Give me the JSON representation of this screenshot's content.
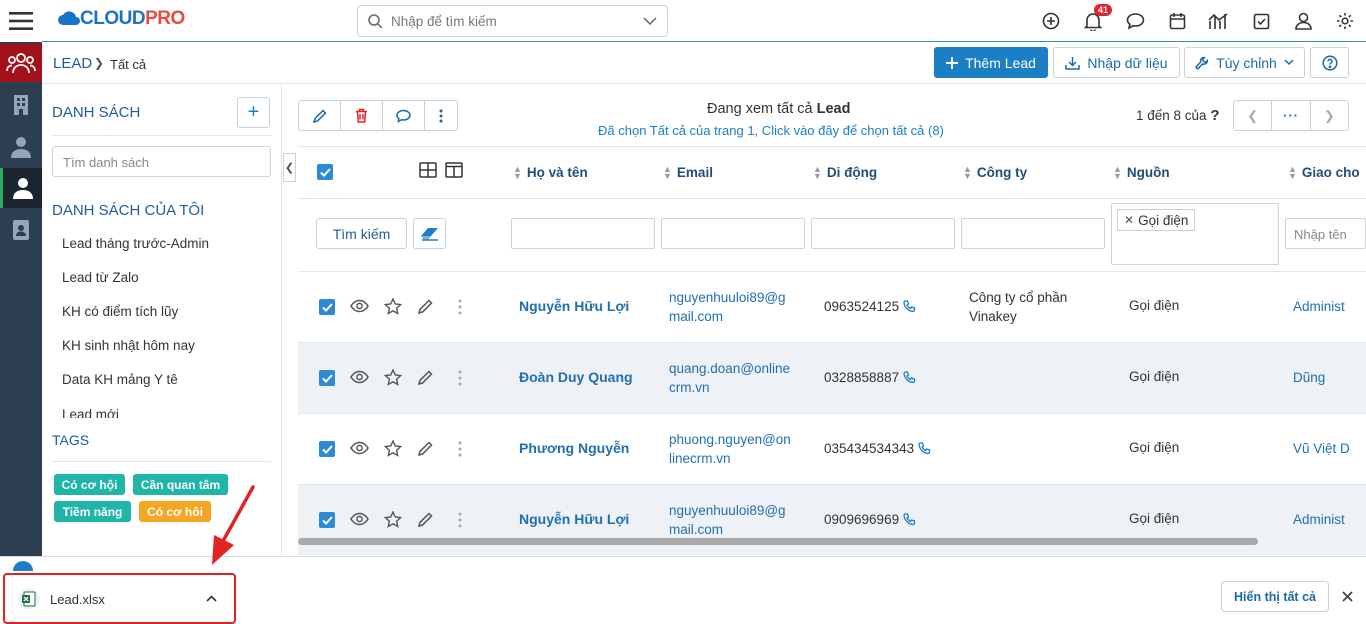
{
  "app": {
    "logo_main": "CLOUD",
    "logo_accent": "PRO"
  },
  "search": {
    "placeholder": "Nhập để tìm kiếm"
  },
  "notifications": {
    "count": "41"
  },
  "breadcrumb": {
    "module": "LEAD",
    "view": "Tất cả"
  },
  "actions": {
    "add_lead": "Thêm Lead",
    "import": "Nhập dữ liệu",
    "customize": "Tùy chỉnh"
  },
  "sidebar": {
    "lists_title": "DANH SÁCH",
    "search_placeholder": "Tìm danh sách",
    "my_lists_title": "DANH SÁCH CỦA TÔI",
    "my_lists": [
      "Lead tháng trước-Admin",
      "Lead từ Zalo",
      "KH có điểm tích lũy",
      "KH sinh nhật hôm nay",
      "Data KH mảng Y tê",
      "Lead mới"
    ],
    "tags_title": "TAGS",
    "tags": [
      {
        "label": "Có cơ hội",
        "color": "#1fb5a8"
      },
      {
        "label": "Cần quan tâm",
        "color": "#1fb5a8"
      },
      {
        "label": "Tiềm năng",
        "color": "#1fb5a8"
      },
      {
        "label": "Có cơ hôi",
        "color": "#f5a623"
      }
    ]
  },
  "listview": {
    "viewing_prefix": "Đang xem tất cả",
    "viewing_module": "Lead",
    "selected_note": "Đã chọn Tất cả của trang 1, Click vào đây để chọn tất cả (8)",
    "pager_text": "1 đến 8 của",
    "pager_unknown": "?",
    "columns": [
      "Họ và tên",
      "Email",
      "Di động",
      "Công ty",
      "Nguồn",
      "Giao cho"
    ],
    "search_button": "Tìm kiếm",
    "source_filter_chip": "Gọi điện",
    "assignee_filter_placeholder": "Nhập tên",
    "rows": [
      {
        "name": "Nguyễn Hữu Lợi",
        "email_1": "nguyenhuuloi89@g",
        "email_2": "mail.com",
        "mobile": "0963524125",
        "company_1": "Công ty cổ phần",
        "company_2": "Vinakey",
        "source": "Gọi điện",
        "assignee": "Administ"
      },
      {
        "name": "Đoàn Duy Quang",
        "email_1": "quang.doan@online",
        "email_2": "crm.vn",
        "mobile": "0328858887",
        "company_1": "",
        "company_2": "",
        "source": "Gọi điện",
        "assignee": "Dũng"
      },
      {
        "name": "Phương Nguyễn",
        "email_1": "phuong.nguyen@on",
        "email_2": "linecrm.vn",
        "mobile": "035434534343",
        "company_1": "",
        "company_2": "",
        "source": "Gọi điện",
        "assignee": "Vũ Việt D"
      },
      {
        "name": "Nguyễn Hữu Lợi",
        "email_1": "nguyenhuuloi89@g",
        "email_2": "mail.com",
        "mobile": "0909696969",
        "company_1": "",
        "company_2": "",
        "source": "Gọi điện",
        "assignee": "Administ"
      }
    ]
  },
  "download_bar": {
    "file_name": "Lead.xlsx",
    "show_all": "Hiển thị tất cả"
  },
  "colors": {
    "primary": "#1a7fc4",
    "rail": "#2c3e50",
    "rail_active": "#a3121c",
    "checkbox": "#2d8bd6",
    "highlight": "#e02323"
  }
}
